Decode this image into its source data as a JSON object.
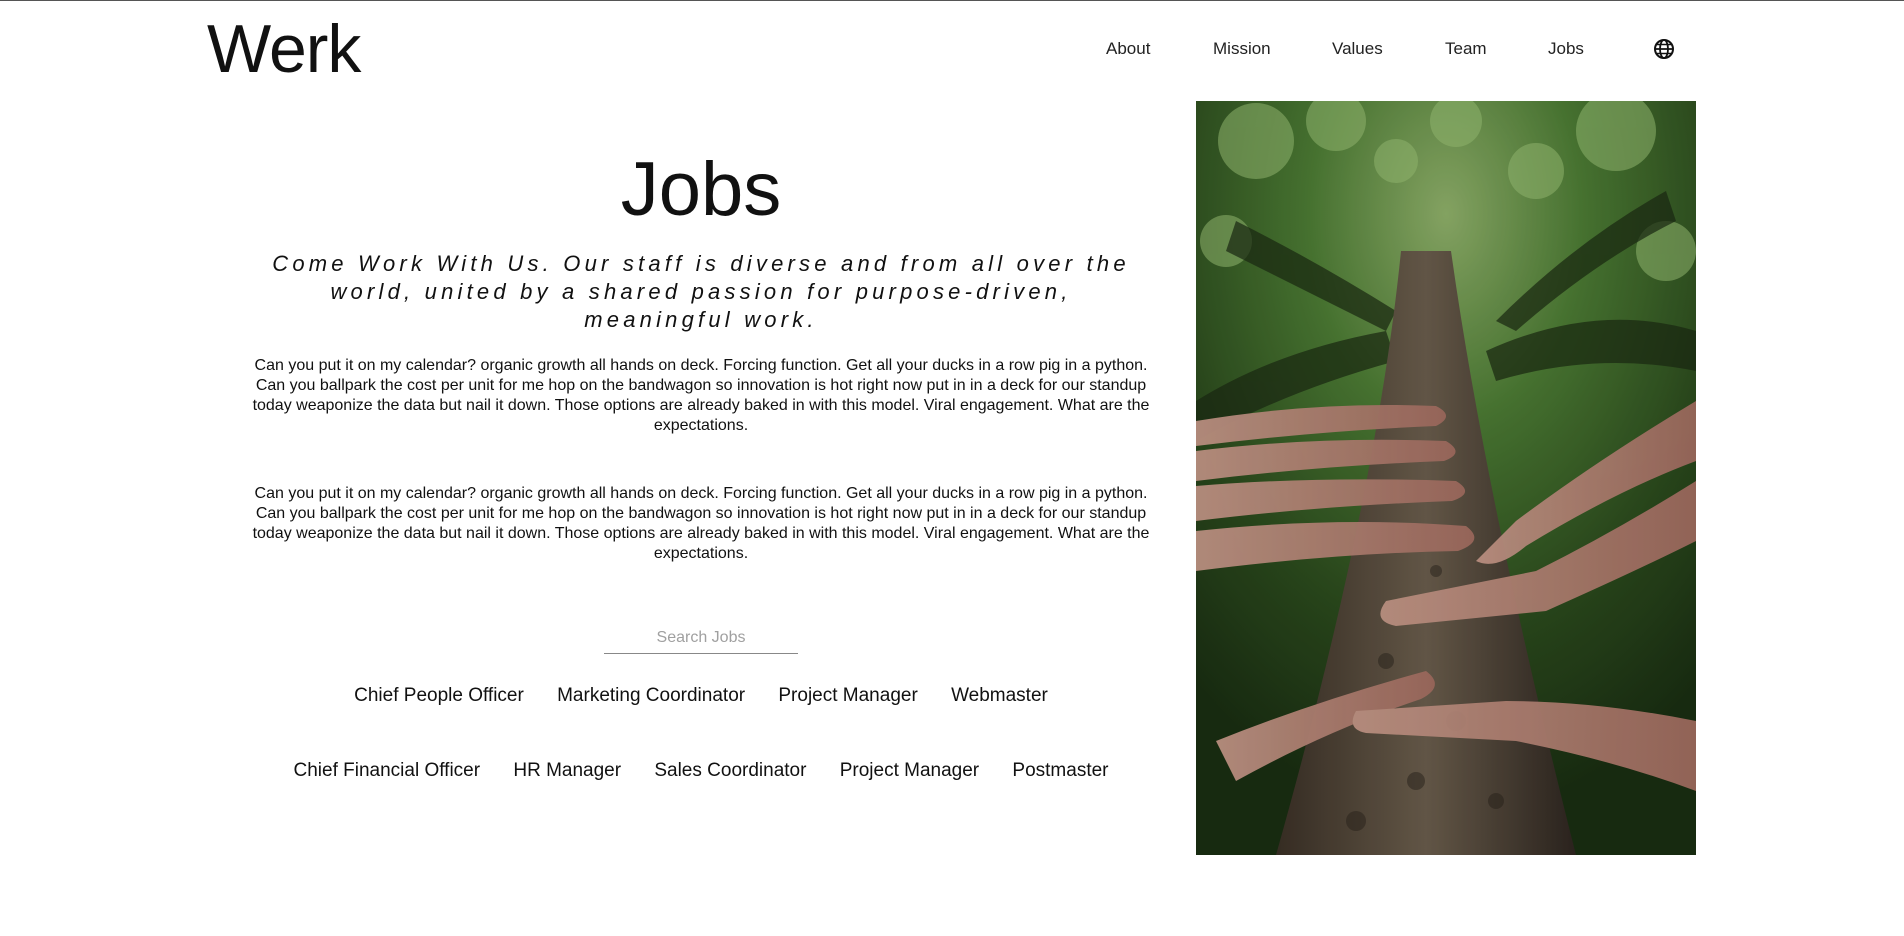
{
  "brand": {
    "logo": "Werk"
  },
  "nav": {
    "items": [
      "About",
      "Mission",
      "Values",
      "Team",
      "Jobs"
    ],
    "language_icon": "globe-icon"
  },
  "main": {
    "title": "Jobs",
    "tagline": "Come Work With Us. Our staff is diverse and from all over the world, united by a shared passion for purpose-driven, meaningful work.",
    "paragraphs": [
      "Can you put it on my calendar? organic growth all hands on deck. Forcing function. Get all your ducks in a row pig in a python. Can you ballpark the cost per unit for me hop on the bandwagon so innovation is hot right now put in in a deck for our standup today weaponize the data but nail it down. Those options are already baked in with this model. Viral engagement. What are the expectations.",
      "Can you put it on my calendar? organic growth all hands on deck. Forcing function. Get all your ducks in a row pig in a python. Can you ballpark the cost per unit for me hop on the bandwagon so innovation is hot right now put in in a deck for our standup today weaponize the data but nail it down. Those options are already baked in with this model. Viral engagement. What are the expectations."
    ]
  },
  "search": {
    "placeholder": "Search Jobs",
    "value": ""
  },
  "jobs": {
    "row1": [
      "Chief People Officer",
      "Marketing Coordinator",
      "Project Manager",
      "Webmaster"
    ],
    "row2": [
      "Chief Financial Officer",
      "HR Manager",
      "Sales Coordinator",
      "Project Manager",
      "Postmaster"
    ]
  },
  "hero_image": {
    "subject": "hands-on-tree-trunk-photo"
  },
  "colors": {
    "text": "#111111",
    "background": "#ffffff",
    "search_underline": "#888888"
  }
}
